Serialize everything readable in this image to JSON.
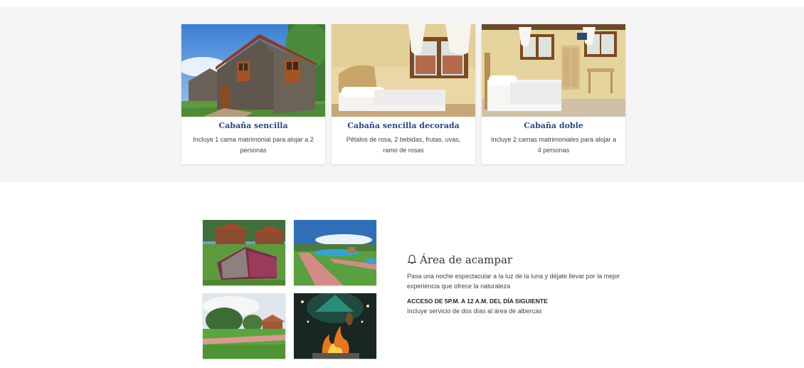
{
  "cabins": [
    {
      "title": "Cabaña sencilla",
      "description": "Incluye 1 cama matrimonial para alojar a 2 personas",
      "image": "stone-cabin-exterior-photo"
    },
    {
      "title": "Cabaña sencilla decorada",
      "description": "Pétalos de rosa, 2 bebidas, frutas, uvas, ramo de rosas",
      "image": "single-bed-room-photo"
    },
    {
      "title": "Cabaña doble",
      "description": "Incluye 2 camas matrimoniales para alojar a 4 personas",
      "image": "double-bed-room-photo"
    }
  ],
  "camping": {
    "icon": "bell-icon",
    "title": "Área de acampar",
    "description": "Pasa una noche espectacular a la luz de la luna y déjate llevar por la mejor experiencia que ofrece la naturaleza",
    "access": "ACCESO DE 5P.M. A 12 A.M. DEL DÍA SIGUIENTE",
    "note": "Incluye servicio de dos días al área de albercas",
    "gallery": [
      "tent-photo",
      "pool-area-photo",
      "garden-photo",
      "campfire-photo"
    ]
  },
  "colors": {
    "band_background": "#f5f5f5",
    "card_title": "#274a8c",
    "camp_title": "#2d3a2a"
  }
}
